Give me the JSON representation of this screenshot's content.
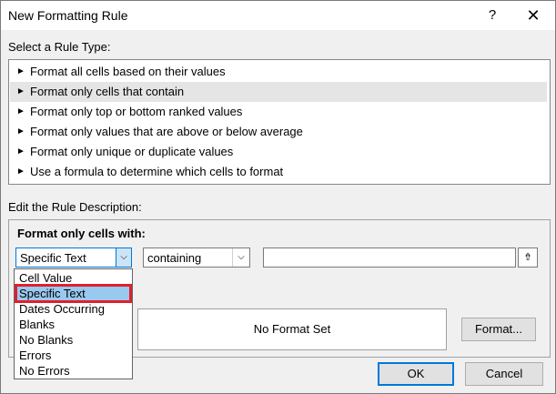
{
  "window": {
    "title": "New Formatting Rule",
    "help": "?",
    "close": "✕"
  },
  "rule_type": {
    "label": "Select a Rule Type:",
    "items": [
      {
        "label": "Format all cells based on their values"
      },
      {
        "label": "Format only cells that contain",
        "selected": true
      },
      {
        "label": "Format only top or bottom ranked values"
      },
      {
        "label": "Format only values that are above or below average"
      },
      {
        "label": "Format only unique or duplicate values"
      },
      {
        "label": "Use a formula to determine which cells to format"
      }
    ]
  },
  "description": {
    "label": "Edit the Rule Description:",
    "heading": "Format only cells with:",
    "type_select": "Specific Text",
    "operator_select": "containing",
    "text_value": "",
    "dropdown_options": [
      "Cell Value",
      "Specific Text",
      "Dates Occurring",
      "Blanks",
      "No Blanks",
      "Errors",
      "No Errors"
    ],
    "highlighted_option": "Specific Text",
    "preview_label": "",
    "preview_text": "No Format Set",
    "format_button": "Format..."
  },
  "buttons": {
    "ok": "OK",
    "cancel": "Cancel"
  },
  "icons": {
    "bullet": "►",
    "dropdown": "⌵",
    "range_ref": "⇮"
  },
  "colors": {
    "highlight_outline": "#e0202e",
    "highlight_fill": "#99c9ef",
    "accent": "#0078d7"
  }
}
